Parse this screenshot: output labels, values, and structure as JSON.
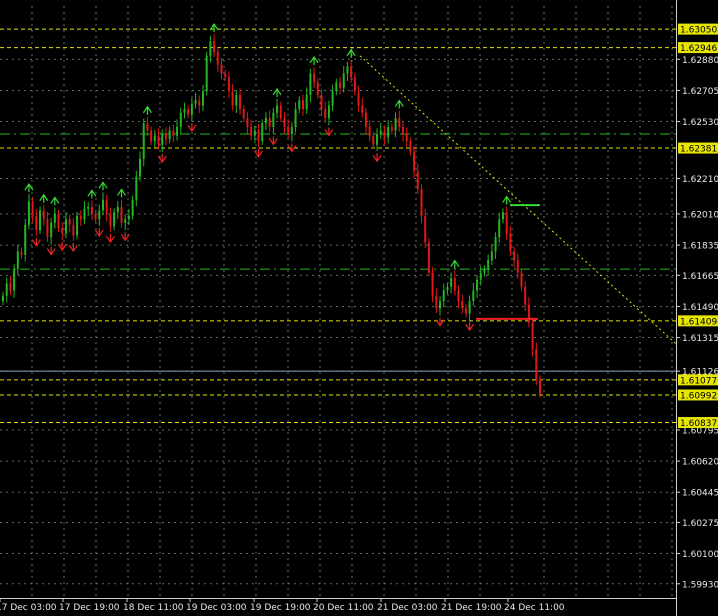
{
  "chart_data": {
    "type": "candlestick",
    "symbol": "",
    "ylim": [
      1.5985,
      1.6318
    ],
    "price_axis_ticks": [
      "1.62880",
      "1.62705",
      "1.62530",
      "1.62210",
      "1.62010",
      "1.61835",
      "1.61665",
      "1.61490",
      "1.61315",
      "1.61126",
      "1.60795",
      "1.60620",
      "1.60445",
      "1.60275",
      "1.60100",
      "1.59930"
    ],
    "time_axis_ticks": [
      "17 Dec 03:00",
      "17 Dec 19:00",
      "18 Dec 11:00",
      "19 Dec 03:00",
      "19 Dec 19:00",
      "20 Dec 11:00",
      "21 Dec 03:00",
      "21 Dec 19:00",
      "24 Dec 11:00"
    ],
    "levels": [
      {
        "price": 1.6305,
        "label": "1.63050",
        "style": "dashed",
        "color": "#e6e600"
      },
      {
        "price": 1.62946,
        "label": "1.62946",
        "style": "dashed",
        "color": "#e6e600"
      },
      {
        "price": 1.62381,
        "label": "1.62381",
        "style": "dashed",
        "color": "#e6e600"
      },
      {
        "price": 1.61409,
        "label": "1.61409",
        "style": "dashed",
        "color": "#e6e600"
      },
      {
        "price": 1.61077,
        "label": "1.61077",
        "style": "dashed",
        "color": "#e6e600"
      },
      {
        "price": 1.60992,
        "label": "1.60992",
        "style": "dashed",
        "color": "#e6e600"
      },
      {
        "price": 1.60837,
        "label": "1.60837",
        "style": "dashed",
        "color": "#e6e600"
      }
    ],
    "green_levels": [
      1.6246,
      1.617
    ],
    "bid_price": 1.61126,
    "closes": [
      1.6155,
      1.6162,
      1.6158,
      1.617,
      1.618,
      1.6178,
      1.6195,
      1.6208,
      1.62,
      1.6192,
      1.6203,
      1.6198,
      1.6188,
      1.6196,
      1.6201,
      1.6193,
      1.619,
      1.6198,
      1.6195,
      1.6189,
      1.62,
      1.6198,
      1.6204,
      1.6205,
      1.6201,
      1.6198,
      1.6203,
      1.6209,
      1.6201,
      1.6194,
      1.6202,
      1.6205,
      1.6196,
      1.6198,
      1.62,
      1.6209,
      1.6222,
      1.6232,
      1.6252,
      1.6248,
      1.6242,
      1.6245,
      1.624,
      1.6246,
      1.6243,
      1.6248,
      1.6245,
      1.625,
      1.6258,
      1.626,
      1.6257,
      1.6263,
      1.6265,
      1.6262,
      1.627,
      1.629,
      1.6298,
      1.6292,
      1.6285,
      1.628,
      1.6278,
      1.627,
      1.6262,
      1.6268,
      1.626,
      1.6255,
      1.625,
      1.6245,
      1.6248,
      1.6242,
      1.6252,
      1.6255,
      1.625,
      1.6258,
      1.6262,
      1.6255,
      1.625,
      1.6246,
      1.625,
      1.626,
      1.6265,
      1.626,
      1.6268,
      1.628,
      1.6275,
      1.6268,
      1.626,
      1.6255,
      1.6262,
      1.627,
      1.6275,
      1.6272,
      1.628,
      1.6284,
      1.6278,
      1.627,
      1.6262,
      1.6258,
      1.625,
      1.6245,
      1.624,
      1.6246,
      1.6248,
      1.6244,
      1.625,
      1.6248,
      1.6255,
      1.625,
      1.6246,
      1.6242,
      1.6236,
      1.6225,
      1.6215,
      1.62,
      1.6185,
      1.6168,
      1.6155,
      1.6148,
      1.6152,
      1.6158,
      1.616,
      1.6165,
      1.6158,
      1.6152,
      1.6148,
      1.6145,
      1.6152,
      1.6158,
      1.6164,
      1.6168,
      1.617,
      1.6175,
      1.618,
      1.6188,
      1.6198,
      1.6202,
      1.619,
      1.618,
      1.6175,
      1.6168,
      1.616,
      1.615,
      1.614,
      1.6125,
      1.6108,
      1.61
    ]
  }
}
